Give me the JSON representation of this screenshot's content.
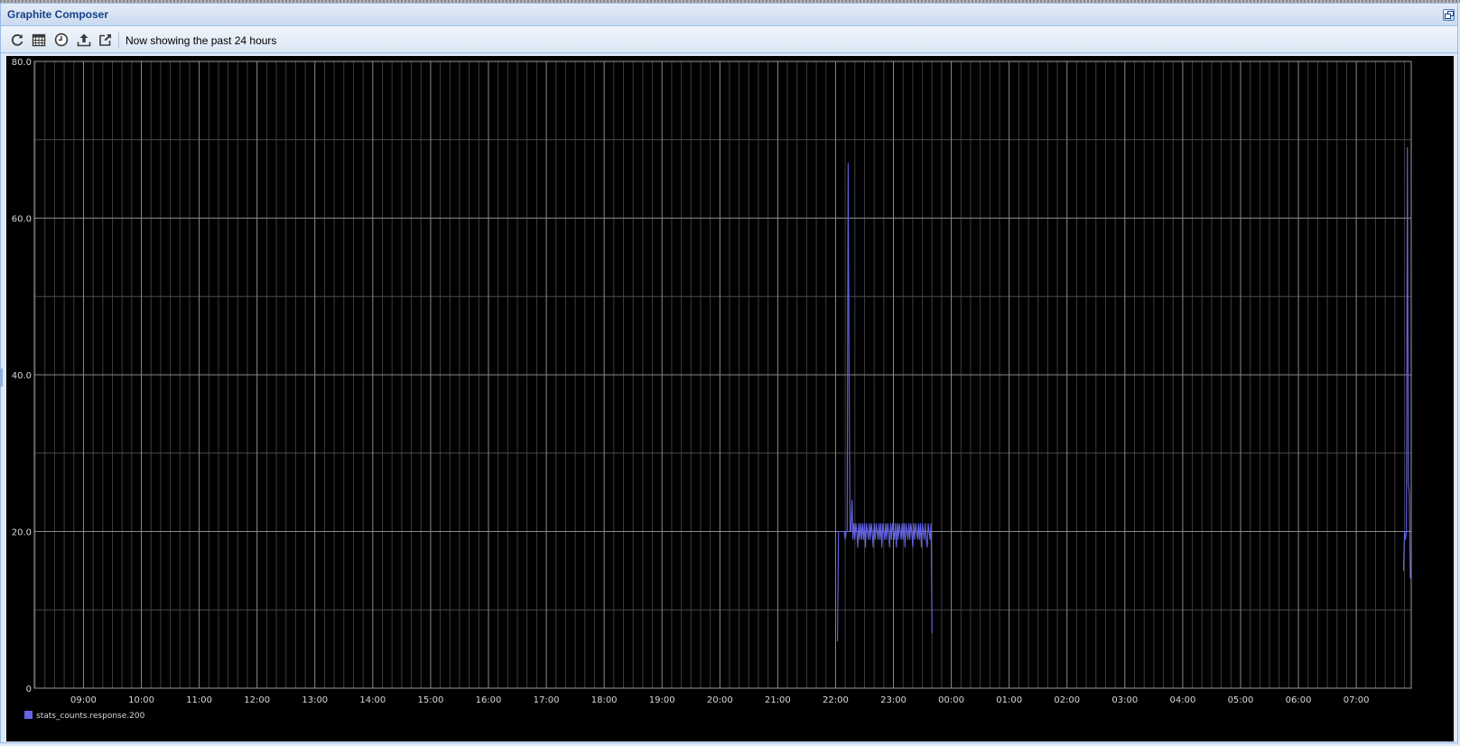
{
  "window": {
    "title": "Graphite Composer",
    "restore_icon": "restore-window-icon"
  },
  "toolbar": {
    "icons": [
      "refresh-icon",
      "calendar-icon",
      "clock-icon",
      "upload-icon",
      "share-icon"
    ],
    "status": "Now showing the past 24 hours"
  },
  "chart_data": {
    "type": "line",
    "background": "#000000",
    "series": [
      {
        "name": "stats_counts.response.200",
        "color": "#6464e6",
        "points": [
          [
            "22:02",
            6
          ],
          [
            "22:03",
            20
          ],
          [
            "22:05",
            20
          ],
          [
            "22:07",
            20
          ],
          [
            "22:09",
            20
          ],
          [
            "22:10",
            19
          ],
          [
            "22:11",
            20
          ],
          [
            "22:12",
            20
          ],
          [
            "22:13",
            67
          ],
          [
            "22:14",
            40
          ],
          [
            "22:15",
            20
          ],
          [
            "22:16",
            20
          ],
          [
            "22:17",
            24
          ],
          [
            "22:18",
            19
          ],
          [
            "22:19",
            21
          ],
          [
            "22:20",
            19
          ],
          [
            "22:21",
            21
          ],
          [
            "22:22",
            20
          ],
          [
            "22:23",
            18
          ],
          [
            "22:24",
            21
          ],
          [
            "22:25",
            19
          ],
          [
            "22:26",
            21
          ],
          [
            "22:27",
            19
          ],
          [
            "22:28",
            21
          ],
          [
            "22:29",
            19
          ],
          [
            "22:30",
            21
          ],
          [
            "22:31",
            18
          ],
          [
            "22:32",
            21
          ],
          [
            "22:33",
            20
          ],
          [
            "22:34",
            19
          ],
          [
            "22:35",
            21
          ],
          [
            "22:36",
            19
          ],
          [
            "22:37",
            21
          ],
          [
            "22:38",
            20
          ],
          [
            "22:39",
            18
          ],
          [
            "22:40",
            21
          ],
          [
            "22:41",
            19
          ],
          [
            "22:42",
            21
          ],
          [
            "22:43",
            20
          ],
          [
            "22:44",
            19
          ],
          [
            "22:45",
            21
          ],
          [
            "22:46",
            19
          ],
          [
            "22:47",
            21
          ],
          [
            "22:48",
            18
          ],
          [
            "22:49",
            21
          ],
          [
            "22:50",
            20
          ],
          [
            "22:51",
            19
          ],
          [
            "22:52",
            21
          ],
          [
            "22:53",
            19
          ],
          [
            "22:54",
            21
          ],
          [
            "22:55",
            20
          ],
          [
            "22:56",
            18
          ],
          [
            "22:57",
            21
          ],
          [
            "22:58",
            19
          ],
          [
            "22:59",
            21
          ],
          [
            "23:00",
            20
          ],
          [
            "23:01",
            19
          ],
          [
            "23:02",
            21
          ],
          [
            "23:03",
            18
          ],
          [
            "23:04",
            21
          ],
          [
            "23:05",
            19
          ],
          [
            "23:06",
            21
          ],
          [
            "23:07",
            20
          ],
          [
            "23:08",
            19
          ],
          [
            "23:09",
            21
          ],
          [
            "23:10",
            19
          ],
          [
            "23:11",
            21
          ],
          [
            "23:12",
            18
          ],
          [
            "23:13",
            21
          ],
          [
            "23:14",
            20
          ],
          [
            "23:15",
            19
          ],
          [
            "23:16",
            21
          ],
          [
            "23:17",
            19
          ],
          [
            "23:18",
            21
          ],
          [
            "23:19",
            20
          ],
          [
            "23:20",
            18
          ],
          [
            "23:21",
            21
          ],
          [
            "23:22",
            19
          ],
          [
            "23:23",
            21
          ],
          [
            "23:24",
            20
          ],
          [
            "23:25",
            19
          ],
          [
            "23:26",
            21
          ],
          [
            "23:27",
            19
          ],
          [
            "23:28",
            21
          ],
          [
            "23:29",
            18
          ],
          [
            "23:30",
            21
          ],
          [
            "23:31",
            20
          ],
          [
            "23:32",
            19
          ],
          [
            "23:33",
            21
          ],
          [
            "23:34",
            19
          ],
          [
            "23:35",
            18
          ],
          [
            "23:36",
            21
          ],
          [
            "23:37",
            20
          ],
          [
            "23:38",
            19
          ],
          [
            "23:39",
            21
          ],
          [
            "23:40",
            7
          ],
          null,
          [
            "07:49",
            15
          ],
          [
            "07:50",
            20
          ],
          [
            "07:51",
            19
          ],
          [
            "07:52",
            20
          ],
          [
            "07:53",
            69
          ],
          [
            "07:54",
            26
          ],
          [
            "07:55",
            25
          ],
          [
            "07:56",
            14
          ]
        ]
      }
    ],
    "x_tick_labels": [
      "09:00",
      "10:00",
      "11:00",
      "12:00",
      "13:00",
      "14:00",
      "15:00",
      "16:00",
      "17:00",
      "18:00",
      "19:00",
      "20:00",
      "21:00",
      "22:00",
      "23:00",
      "00:00",
      "01:00",
      "02:00",
      "03:00",
      "04:00",
      "05:00",
      "06:00",
      "07:00"
    ],
    "x_range": [
      "08:09",
      "07:57"
    ],
    "y_tick_labels": [
      "0",
      "20.0",
      "40.0",
      "60.0",
      "80.0"
    ],
    "ylim": [
      0,
      80
    ],
    "y_major_step": 20,
    "y_minor_step": 10,
    "x_minor_step_minutes": 10,
    "grid": true,
    "legend_position": "bottom-left"
  }
}
